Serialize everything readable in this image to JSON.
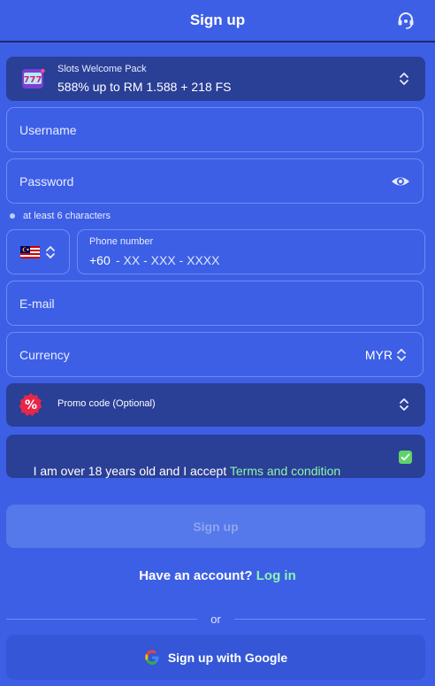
{
  "header": {
    "title": "Sign up"
  },
  "bonus": {
    "label": "Slots Welcome Pack",
    "value": "588% up to RM 1.588 + 218 FS"
  },
  "username": {
    "placeholder": "Username"
  },
  "password": {
    "placeholder": "Password",
    "hint": "at least 6 characters"
  },
  "phone": {
    "label": "Phone number",
    "prefix": "+60",
    "mask": "- XX - XXX - XXXX",
    "flag": "malaysia-flag"
  },
  "email": {
    "placeholder": "E-mail"
  },
  "currency": {
    "label": "Currency",
    "value": "MYR"
  },
  "promo": {
    "label": "Promo code (Optional)"
  },
  "terms": {
    "text": "I am over 18 years old and I accept ",
    "link": "Terms and condition",
    "checked": true
  },
  "signup_button": {
    "label": "Sign up"
  },
  "account": {
    "question": "Have an account?",
    "login": "Log in"
  },
  "divider": {
    "text": "or"
  },
  "google_button": {
    "label": "Sign up with Google"
  }
}
